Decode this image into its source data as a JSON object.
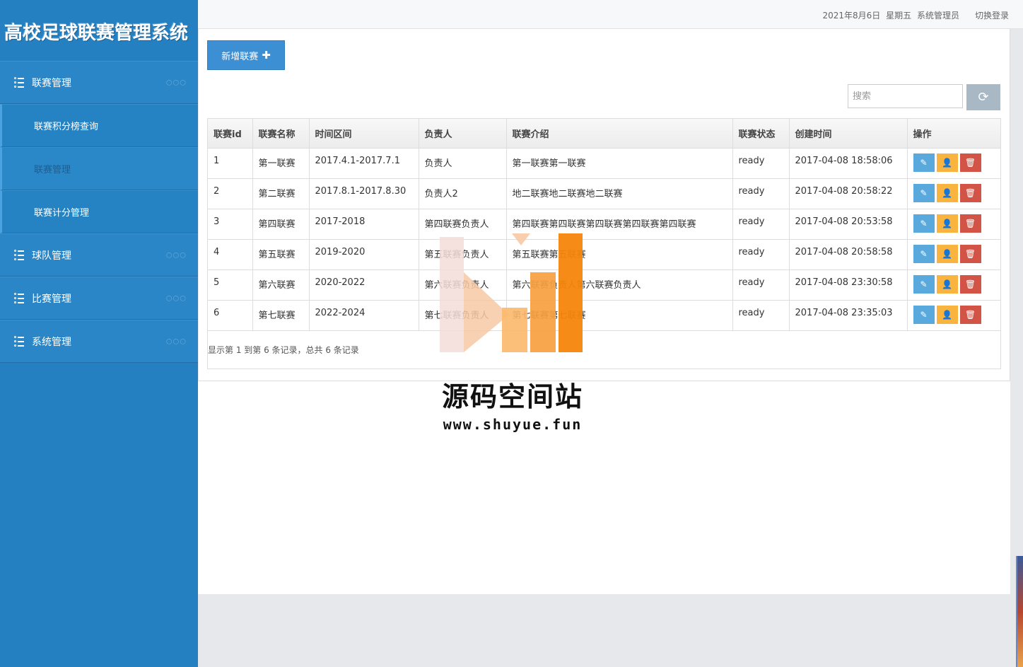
{
  "app": {
    "title": "高校足球联赛管理系统"
  },
  "header": {
    "date": "2021年8月6日",
    "weekday": "星期五",
    "user": "系统管理员",
    "logout": "切换登录"
  },
  "sidebar": {
    "menus": [
      {
        "label": "联赛管理",
        "icon": "list-icon",
        "dots": "○○○"
      },
      {
        "label": "球队管理",
        "icon": "list-icon",
        "dots": "○○○"
      },
      {
        "label": "比赛管理",
        "icon": "list-icon",
        "dots": "○○○"
      },
      {
        "label": "系统管理",
        "icon": "list-icon",
        "dots": "○○○"
      }
    ],
    "submenus": [
      {
        "label": "联赛积分榜查询"
      },
      {
        "label": "联赛管理"
      },
      {
        "label": "联赛计分管理"
      }
    ]
  },
  "toolbar": {
    "add_label": "新增联赛",
    "add_icon": "plus-icon",
    "search_placeholder": "搜索",
    "refresh_icon": "refresh-icon"
  },
  "table": {
    "headers": [
      "联赛id",
      "联赛名称",
      "时间区间",
      "负责人",
      "联赛介绍",
      "联赛状态",
      "创建时间",
      "操作"
    ],
    "rows": [
      [
        "1",
        "第一联赛",
        "2017.4.1-2017.7.1",
        "负责人",
        "第一联赛第一联赛",
        "ready",
        "2017-04-08 18:58:06"
      ],
      [
        "2",
        "第二联赛",
        "2017.8.1-2017.8.30",
        "负责人2",
        "地二联赛地二联赛地二联赛",
        "ready",
        "2017-04-08 20:58:22"
      ],
      [
        "3",
        "第四联赛",
        "2017-2018",
        "第四联赛负责人",
        "第四联赛第四联赛第四联赛第四联赛第四联赛",
        "ready",
        "2017-04-08 20:53:58"
      ],
      [
        "4",
        "第五联赛",
        "2019-2020",
        "第五联赛负责人",
        "第五联赛第五联赛",
        "ready",
        "2017-04-08 20:58:58"
      ],
      [
        "5",
        "第六联赛",
        "2020-2022",
        "第六联赛负责人",
        "第六联赛负责人第六联赛负责人",
        "ready",
        "2017-04-08 23:30:58"
      ],
      [
        "6",
        "第七联赛",
        "2022-2024",
        "第七联赛负责人",
        "第七联赛第七联赛",
        "ready",
        "2017-04-08 23:35:03"
      ]
    ],
    "op_icons": [
      "edit-icon",
      "user-icon",
      "delete-icon"
    ],
    "summary": "显示第 1 到第 6 条记录，总共 6 条记录"
  },
  "watermark": {
    "name": "源码空间站",
    "url": "www.shuyue.fun"
  },
  "colors": {
    "sidebar": "#2580c1",
    "accent": "#3d8fd4",
    "edit": "#5aa9dd",
    "user": "#f9b33f",
    "delete": "#d25446"
  }
}
